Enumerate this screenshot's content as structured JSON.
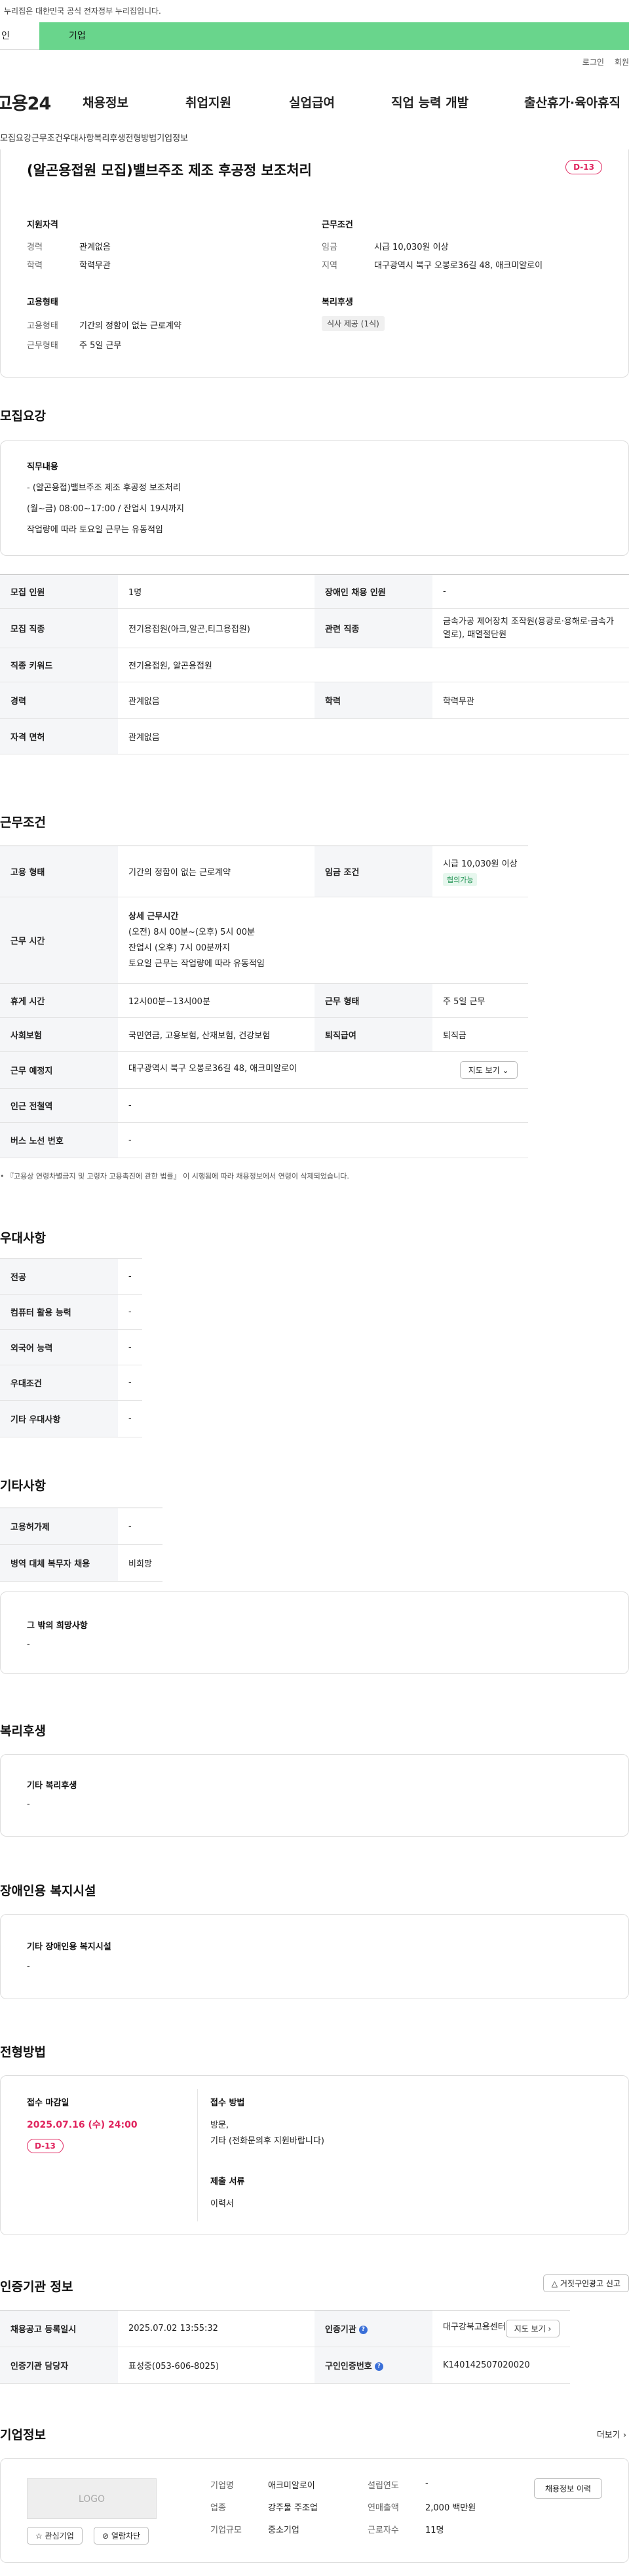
{
  "gov_notice": "누리집은 대한민국 공식 전자정부 누리집입니다.",
  "tabs": [
    "인",
    "기업"
  ],
  "util": [
    "로그인",
    "회원"
  ],
  "logo": "고용24",
  "gnb": [
    "채용정보",
    "취업지원",
    "실업급여",
    "직업 능력 개발",
    "출산휴가·육아휴직"
  ],
  "subnav": [
    "모집요강",
    "근무조건",
    "우대사항",
    "복리후생",
    "전형방법",
    "기업정보"
  ],
  "job": {
    "title": "(알곤용접원 모집)밸브주조 제조 후공정 보조처리",
    "dday": "D-13",
    "qual_title": "지원자격",
    "qual": [
      [
        "경력",
        "관계없음"
      ],
      [
        "학력",
        "학력무관"
      ]
    ],
    "emp_title": "고용형태",
    "emp": [
      [
        "고용형태",
        "기간의 정함이 없는 근로계약"
      ],
      [
        "근무형태",
        "주 5일 근무"
      ]
    ],
    "cond_title": "근무조건",
    "cond": [
      [
        "임금",
        "시급 10,030원 이상"
      ],
      [
        "지역",
        "대구광역시 북구 오봉로36길 48, 애크미알로이"
      ]
    ],
    "welfare_title": "복리후생",
    "welfare_badge": "식사 제공 (1식)"
  },
  "recruit": {
    "heading": "모집요강",
    "duty_title": "직무내용",
    "duty_lines": [
      "- (알곤용접)밸브주조 제조 후공정 보조처리",
      "(월~금) 08:00~17:00 / 잔업시 19시까지",
      "작업량에 따라 토요일 근무는 유동적임"
    ],
    "rows": {
      "r1": [
        "모집 인원",
        "1명",
        "장애인 채용 인원",
        "-"
      ],
      "r2": [
        "모집 직종",
        "전기용접원(아크,알곤,티그용접원)",
        "관련 직종",
        "금속가공 제어장치 조작원(용광로·용해로·금속가열로), 패열절단원"
      ],
      "r3": [
        "직종 키워드",
        "전기용접원, 알곤용접원"
      ],
      "r4": [
        "경력",
        "관계없음",
        "학력",
        "학력무관"
      ],
      "r5": [
        "자격 면허",
        "관계없음"
      ]
    }
  },
  "work": {
    "heading": "근무조건",
    "emp_type": [
      "고용 형태",
      "기간의 정함이 없는 근로계약",
      "임금 조건",
      "시급 10,030원 이상",
      "협의가능"
    ],
    "hours_label": "근무 시간",
    "hours_title": "상세 근무시간",
    "hours_lines": [
      "(오전) 8시 00분~(오후) 5시 00분",
      "잔업시 (오후) 7시 00분까지",
      "토요일 근무는 작업량에 따라 유동적임"
    ],
    "rest": [
      "휴게 시간",
      "12시00분~13시00분",
      "근무 형태",
      "주 5일 근무"
    ],
    "insurance": [
      "사회보험",
      "국민연금, 고용보험, 산재보험, 건강보험",
      "퇴직급여",
      "퇴직금"
    ],
    "place": [
      "근무 예정지",
      "대구광역시 북구 오봉로36길 48, 애크미알로이",
      "지도 보기"
    ],
    "subway": [
      "인근 전철역",
      "-"
    ],
    "bus": [
      "버스 노선 번호",
      "-"
    ],
    "note": "• 『고용상 연령차별금지 및 고령자 고용촉진에 관한 법률』 이 시행됨에 따라 채용정보에서 연령이 삭제되었습니다."
  },
  "pref": {
    "heading": "우대사항",
    "rows": [
      [
        "전공",
        "-"
      ],
      [
        "컴퓨터 활용 능력",
        "-"
      ],
      [
        "외국어 능력",
        "-"
      ],
      [
        "우대조건",
        "-"
      ],
      [
        "기타 우대사항",
        "-"
      ]
    ]
  },
  "etc": {
    "heading": "기타사항",
    "rows": [
      [
        "고용허가제",
        "-"
      ],
      [
        "병역 대체 복무자 채용",
        "비희망"
      ]
    ],
    "hope_title": "그 밖의 희망사항",
    "hope_val": "-"
  },
  "benefit": {
    "heading": "복리후생",
    "title": "기타 복리후생",
    "val": "-"
  },
  "disab": {
    "heading": "장애인용 복지시설",
    "title": "기타 장애인용 복지시설",
    "val": "-"
  },
  "process": {
    "heading": "전형방법",
    "deadline_title": "접수 마감일",
    "deadline": "2025.07.16 (수) 24:00",
    "dday": "D-13",
    "method_title": "접수 방법",
    "method_lines": [
      "방문,",
      "기타 (전화문의후 지원바랍니다)"
    ],
    "docs_title": "제출 서류",
    "docs_val": "이력서"
  },
  "cert": {
    "heading": "인증기관 정보",
    "report_btn": "거짓구인광고 신고",
    "r1": [
      "채용공고 등록일시",
      "2025.07.02 13:55:32",
      "인증기관",
      "대구강북고용센터",
      "지도 보기"
    ],
    "r2": [
      "인증기관 담당자",
      "표성중(053-606-8025)",
      "구인인증번호",
      "K140142507020020"
    ]
  },
  "company": {
    "heading": "기업정보",
    "more": "더보기",
    "logo_text": "LOGO",
    "fav_btn": "관심기업",
    "block_btn": "열람차단",
    "fields": [
      [
        "기업명",
        "애크미알로이",
        "설립연도",
        "-"
      ],
      [
        "업종",
        "강주물 주조업",
        "연매출액",
        "2,000 백만원"
      ],
      [
        "기업규모",
        "중소기업",
        "근로자수",
        "11명"
      ]
    ],
    "history_btn": "채용정보 이력"
  }
}
